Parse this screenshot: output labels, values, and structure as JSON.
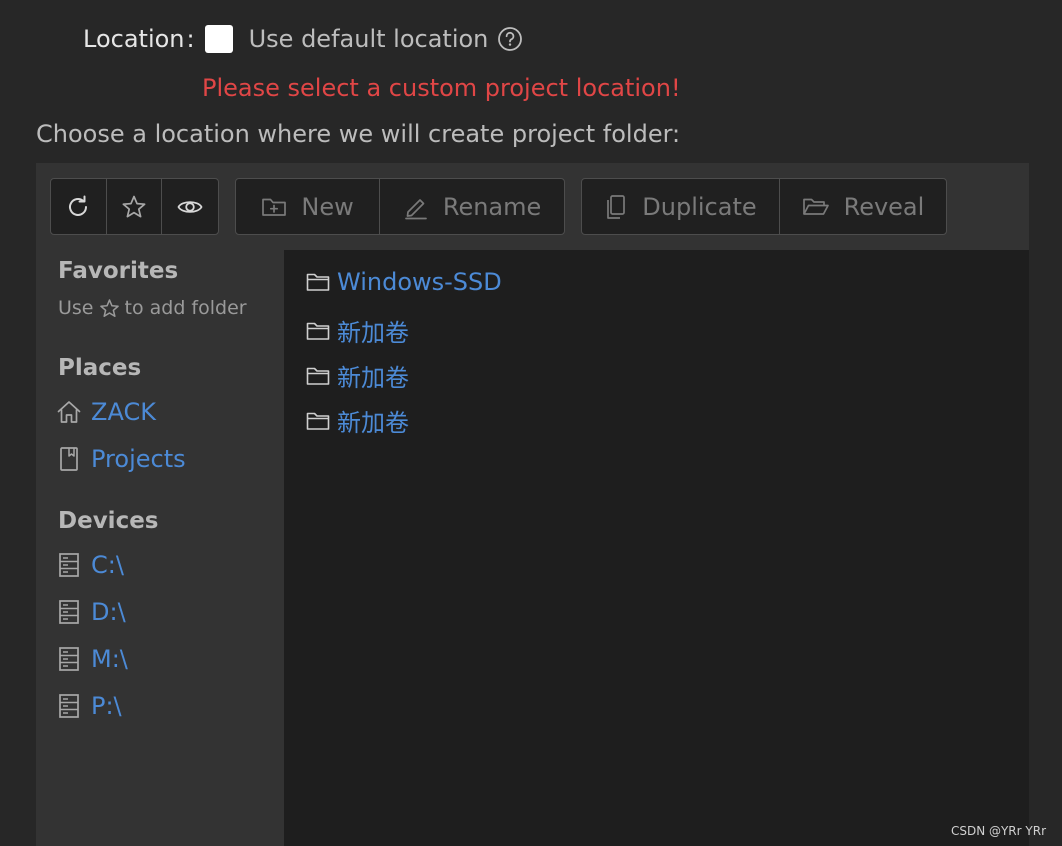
{
  "location": {
    "label": "Location",
    "colon": ":",
    "use_default_label": "Use default location",
    "checkbox_checked": false
  },
  "error_message": "Please select a custom project location!",
  "choose_prompt": "Choose a location where we will create project folder:",
  "toolbar": {
    "refresh_icon": "refresh-icon",
    "favorite_icon": "star-icon",
    "show_hidden_icon": "eye-icon",
    "new_label": "New",
    "rename_label": "Rename",
    "duplicate_label": "Duplicate",
    "reveal_label": "Reveal"
  },
  "sidebar": {
    "favorites_heading": "Favorites",
    "favorites_hint_prefix": "Use",
    "favorites_hint_suffix": "to add folder",
    "places_heading": "Places",
    "places": [
      {
        "label": "ZACK",
        "icon": "home-icon"
      },
      {
        "label": "Projects",
        "icon": "bookmark-icon"
      }
    ],
    "devices_heading": "Devices",
    "devices": [
      {
        "label": "C:\\",
        "icon": "drive-icon"
      },
      {
        "label": "D:\\",
        "icon": "drive-icon"
      },
      {
        "label": "M:\\",
        "icon": "drive-icon"
      },
      {
        "label": "P:\\",
        "icon": "drive-icon"
      }
    ]
  },
  "files": [
    {
      "name": "Windows-SSD",
      "icon": "folder-icon"
    },
    {
      "name": "新加卷",
      "icon": "folder-icon"
    },
    {
      "name": "新加卷",
      "icon": "folder-icon"
    },
    {
      "name": "新加卷",
      "icon": "folder-icon"
    }
  ],
  "watermark": "CSDN @YRr YRr",
  "colors": {
    "background": "#272727",
    "panel": "#333333",
    "file_pane": "#1e1e1e",
    "link": "#4c8ad6",
    "error": "#e04646"
  }
}
